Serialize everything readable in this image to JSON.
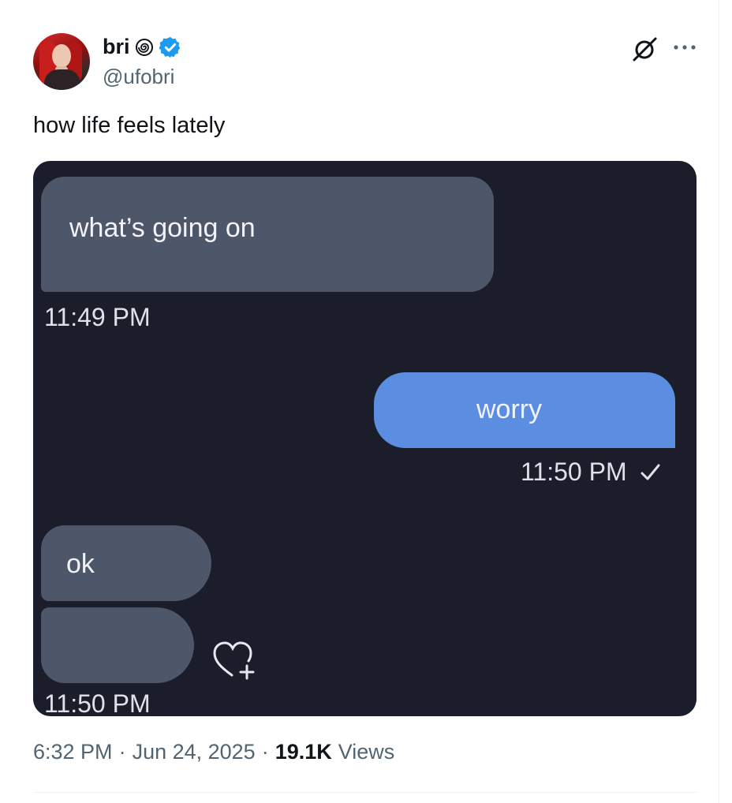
{
  "author": {
    "name": "bri",
    "handle": "@ufobri",
    "verified": true,
    "badge_icon": "spiral-icon",
    "verified_icon": "verified-checkmark-icon",
    "verified_color": "#1d9bf0"
  },
  "tweet": {
    "text": "how life feels lately"
  },
  "actions": {
    "grok_icon": "grok-icon",
    "more_icon": "more-options-icon"
  },
  "media": {
    "background": "#1b1d2b",
    "messages": [
      {
        "direction": "incoming",
        "text": "what’s going on",
        "time": "11:49 PM"
      },
      {
        "direction": "outgoing",
        "text": "worry",
        "time": "11:50 PM",
        "status_icon": "checkmark-icon"
      },
      {
        "direction": "incoming",
        "text": "ok"
      },
      {
        "direction": "incoming",
        "text": "",
        "time": "11:50 PM",
        "reaction_icon": "heart-plus-icon"
      }
    ],
    "incoming_color": "#4e566a",
    "outgoing_color": "#5b8ee0"
  },
  "meta": {
    "time": "6:32 PM",
    "separator": "·",
    "date": "Jun 24, 2025",
    "views_count": "19.1K",
    "views_label": "Views"
  }
}
